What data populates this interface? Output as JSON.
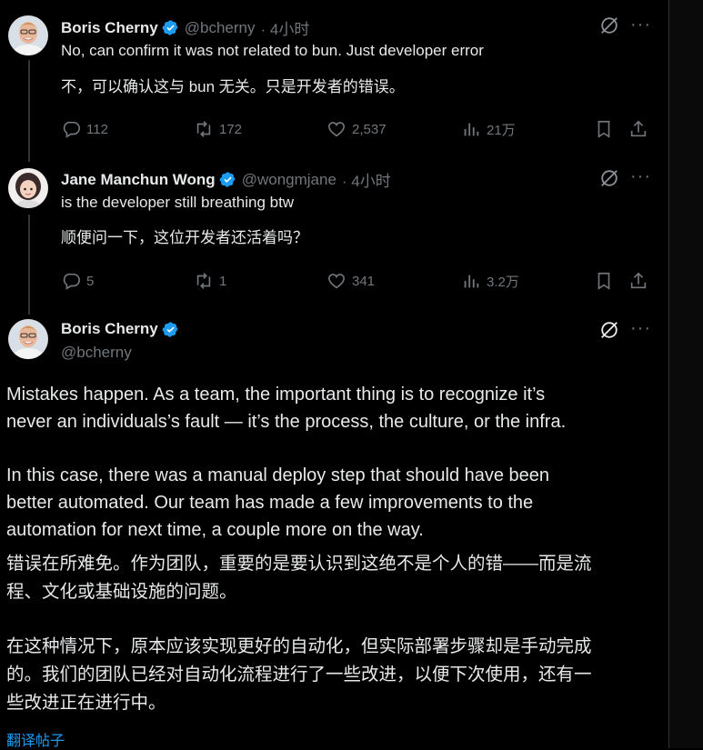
{
  "tweets": [
    {
      "author": "Boris Cherny",
      "handle": "@bcherny",
      "time": "· 4小时",
      "text": "No, can confirm it was not related to bun. Just developer error",
      "translation": "不，可以确认这与 bun 无关。只是开发者的错误。",
      "replies": "112",
      "reposts": "172",
      "likes": "2,537",
      "views": "21万"
    },
    {
      "author": "Jane Manchun Wong",
      "handle": "@wongmjane",
      "time": "· 4小时",
      "text": "is the developer still breathing btw",
      "translation": "顺便问一下，这位开发者还活着吗？",
      "replies": "5",
      "reposts": "1",
      "likes": "341",
      "views": "3.2万"
    }
  ],
  "main_tweet": {
    "author": "Boris Cherny",
    "handle": "@bcherny",
    "en_lines": [
      "Mistakes happen. As a team, the important thing is to recognize it’s",
      "never an individuals’s fault — it’s the process, the culture, or the infra.",
      "In this case, there was a manual deploy step that should have been",
      "better automated. Our team has made a few improvements to the",
      "automation for next time, a couple more on the way."
    ],
    "zh_lines": [
      "错误在所难免。作为团队，重要的是要认识到这绝不是个人的错——而是流",
      "程、文化或基础设施的问题。",
      "在这种情况下，原本应该实现更好的自动化，但实际部署步骤却是手动完成",
      "的。我们的团队已经对自动化流程进行了一些改进，以便下次使用，还有一",
      "些改进正在进行中。"
    ],
    "translate_link": "翻译帖子"
  },
  "icons": {
    "verified": "verified-badge-icon",
    "reply": "reply-icon",
    "repost": "repost-icon",
    "like": "heart-icon",
    "views": "views-icon",
    "bookmark": "bookmark-icon",
    "share": "share-icon",
    "grok": "grok-icon",
    "more": "more-icon"
  },
  "colors": {
    "background": "#000000",
    "text": "#e7e9ea",
    "muted": "#71767b",
    "accent": "#1d9bf0"
  },
  "more_label": "···"
}
